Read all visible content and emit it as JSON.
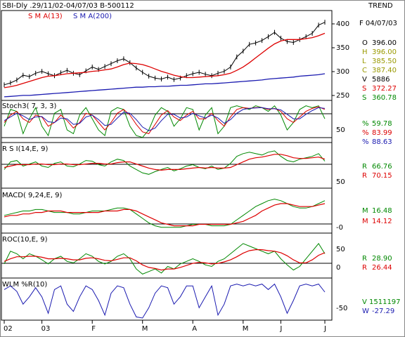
{
  "header": {
    "title": "SBI-Dly .29/11/02-04/07/03 B-500112",
    "indicator": "TREND"
  },
  "colors": {
    "price": "#000000",
    "sma13": "#dd0000",
    "sma200": "#1a1ab0",
    "stoch_k": "#008800",
    "stoch_d": "#dd0000",
    "stoch_third": "#1a1ab0",
    "rsi": "#008800",
    "rsi_avg": "#dd0000",
    "macd": "#008800",
    "macd_signal": "#dd0000",
    "roc": "#008800",
    "roc_avg": "#dd0000",
    "wlm": "#1a1ab0"
  },
  "chart_data": [
    {
      "type": "line",
      "panel": "price",
      "legend": [
        "S M A(13)",
        "S M A(200)"
      ],
      "ylim": [
        240,
        415
      ],
      "yticks": [
        400,
        350,
        300,
        250
      ],
      "date_label": "F 04/07/03",
      "readouts": [
        {
          "label": "O",
          "value": "396.00"
        },
        {
          "label": "H",
          "value": "396.00"
        },
        {
          "label": "L",
          "value": "385.50"
        },
        {
          "label": "C",
          "value": "387.40"
        },
        {
          "label": "V",
          "value": "5886"
        },
        {
          "label": "S",
          "value": "372.27"
        },
        {
          "label": "S",
          "value": "360.78"
        }
      ],
      "series": [
        {
          "name": "Close",
          "values": [
            268,
            272,
            278,
            288,
            285,
            292,
            296,
            291,
            287,
            293,
            298,
            292,
            289,
            297,
            305,
            300,
            306,
            312,
            318,
            322,
            314,
            303,
            294,
            286,
            282,
            280,
            284,
            279,
            282,
            287,
            291,
            294,
            290,
            287,
            292,
            296,
            305,
            326,
            338,
            352,
            355,
            360,
            368,
            377,
            365,
            358,
            356,
            362,
            368,
            375,
            392,
            398
          ]
        },
        {
          "name": "S M A(13)",
          "values": [
            262,
            264,
            267,
            271,
            275,
            279,
            283,
            286,
            287,
            289,
            291,
            292,
            293,
            294,
            296,
            297,
            299,
            301,
            305,
            310,
            313,
            312,
            310,
            306,
            301,
            296,
            292,
            288,
            285,
            283,
            283,
            284,
            285,
            286,
            287,
            289,
            292,
            298,
            305,
            314,
            324,
            334,
            344,
            353,
            359,
            362,
            362,
            362,
            364,
            366,
            370,
            375
          ]
        },
        {
          "name": "S M A(200)",
          "values": [
            243,
            244,
            245,
            246,
            246,
            247,
            248,
            249,
            250,
            251,
            252,
            253,
            254,
            255,
            256,
            257,
            258,
            259,
            260,
            261,
            262,
            263,
            263,
            264,
            264,
            265,
            265,
            266,
            267,
            267,
            268,
            269,
            270,
            270,
            271,
            272,
            273,
            274,
            275,
            276,
            277,
            278,
            280,
            281,
            282,
            283,
            284,
            286,
            287,
            288,
            289,
            291
          ]
        }
      ]
    },
    {
      "type": "line",
      "panel": "stochastic",
      "title": "Stoch3( 7, 3, 3)",
      "ylim": [
        0,
        100
      ],
      "ytick": "50",
      "readouts": [
        {
          "label": "%",
          "value": "59.78"
        },
        {
          "label": "%",
          "value": "83.99"
        },
        {
          "label": "%",
          "value": "88.63"
        }
      ],
      "series": [
        {
          "name": "K",
          "values": [
            40,
            85,
            80,
            20,
            60,
            90,
            40,
            15,
            75,
            85,
            30,
            20,
            70,
            90,
            60,
            30,
            15,
            80,
            90,
            85,
            40,
            15,
            10,
            30,
            70,
            90,
            80,
            40,
            60,
            90,
            85,
            30,
            70,
            90,
            20,
            40,
            90,
            95,
            90,
            85,
            95,
            90,
            80,
            95,
            70,
            30,
            50,
            85,
            95,
            90,
            95,
            60
          ]
        },
        {
          "name": "D",
          "values": [
            50,
            70,
            80,
            60,
            50,
            70,
            65,
            40,
            50,
            70,
            55,
            35,
            50,
            75,
            70,
            50,
            30,
            50,
            75,
            85,
            70,
            45,
            25,
            20,
            45,
            70,
            82,
            65,
            55,
            70,
            80,
            60,
            60,
            75,
            55,
            40,
            65,
            85,
            90,
            88,
            90,
            90,
            85,
            88,
            80,
            60,
            50,
            65,
            80,
            88,
            92,
            85
          ]
        },
        {
          "name": "S",
          "values": [
            55,
            65,
            75,
            68,
            58,
            65,
            66,
            52,
            50,
            62,
            60,
            45,
            48,
            65,
            70,
            58,
            42,
            45,
            62,
            78,
            75,
            58,
            38,
            28,
            35,
            55,
            72,
            72,
            62,
            65,
            75,
            68,
            62,
            70,
            62,
            48,
            58,
            75,
            85,
            88,
            89,
            90,
            87,
            87,
            84,
            72,
            60,
            60,
            72,
            82,
            90,
            88
          ]
        }
      ]
    },
    {
      "type": "line",
      "panel": "rsi",
      "title": "R S I(14,E, 9)",
      "ylim": [
        30,
        90
      ],
      "ytick": "50",
      "reference_line": 70,
      "readouts": [
        {
          "label": "R",
          "value": "66.76"
        },
        {
          "label": "R",
          "value": "70.15"
        }
      ],
      "series": [
        {
          "name": "RSI",
          "values": [
            55,
            66,
            68,
            60,
            63,
            66,
            60,
            58,
            64,
            66,
            60,
            59,
            63,
            68,
            67,
            62,
            60,
            66,
            70,
            68,
            60,
            55,
            50,
            48,
            52,
            55,
            58,
            53,
            56,
            60,
            62,
            58,
            56,
            60,
            55,
            57,
            64,
            74,
            78,
            80,
            78,
            76,
            80,
            82,
            74,
            68,
            66,
            70,
            72,
            74,
            78,
            67
          ]
        },
        {
          "name": "Average",
          "values": [
            58,
            60,
            62,
            62,
            62,
            63,
            63,
            62,
            62,
            63,
            63,
            62,
            62,
            63,
            64,
            64,
            63,
            63,
            65,
            66,
            66,
            63,
            60,
            57,
            55,
            54,
            55,
            55,
            55,
            56,
            57,
            58,
            57,
            58,
            57,
            57,
            58,
            62,
            66,
            70,
            72,
            73,
            75,
            77,
            77,
            75,
            72,
            71,
            71,
            72,
            73,
            70
          ]
        }
      ]
    },
    {
      "type": "line",
      "panel": "macd",
      "title": "MACD( 9,24,E, 9)",
      "ylim": [
        -4,
        24
      ],
      "ytick": "-0",
      "reference_line": 0,
      "readouts": [
        {
          "label": "M",
          "value": "16.48"
        },
        {
          "label": "M",
          "value": "14.12"
        }
      ],
      "series": [
        {
          "name": "MACD",
          "values": [
            7,
            8,
            9,
            10,
            10,
            11,
            11,
            10,
            9,
            9,
            9,
            8,
            8,
            9,
            10,
            10,
            10,
            11,
            12,
            12,
            11,
            8,
            5,
            2,
            0,
            -1,
            -1,
            -1,
            -1,
            0,
            1,
            1,
            1,
            0,
            0,
            0,
            1,
            4,
            7,
            10,
            13,
            15,
            17,
            18,
            17,
            15,
            13,
            12,
            12,
            13,
            15,
            17
          ]
        },
        {
          "name": "Signal",
          "values": [
            6,
            7,
            7,
            8,
            8,
            9,
            9,
            10,
            10,
            10,
            9,
            9,
            9,
            9,
            9,
            9,
            10,
            10,
            10,
            11,
            11,
            10,
            8,
            6,
            4,
            2,
            1,
            0,
            0,
            0,
            0,
            1,
            1,
            1,
            1,
            1,
            1,
            2,
            3,
            5,
            7,
            10,
            12,
            14,
            15,
            15,
            14,
            13,
            13,
            13,
            14,
            15
          ]
        }
      ]
    },
    {
      "type": "line",
      "panel": "roc",
      "title": "ROC(10,E, 9)",
      "ylim": [
        -15,
        65
      ],
      "yticks": [
        "50",
        "0"
      ],
      "reference_line": 0,
      "readouts": [
        {
          "label": "R",
          "value": "28.90"
        },
        {
          "label": "R",
          "value": "26.44"
        }
      ],
      "series": [
        {
          "name": "ROC",
          "values": [
            10,
            35,
            30,
            20,
            30,
            25,
            18,
            10,
            20,
            25,
            15,
            12,
            20,
            30,
            25,
            15,
            10,
            15,
            25,
            30,
            20,
            0,
            -10,
            -5,
            0,
            -8,
            5,
            0,
            10,
            15,
            20,
            15,
            8,
            5,
            15,
            20,
            30,
            40,
            50,
            45,
            40,
            35,
            30,
            35,
            20,
            8,
            -2,
            5,
            20,
            35,
            50,
            30
          ]
        },
        {
          "name": "Average",
          "values": [
            15,
            20,
            24,
            24,
            25,
            25,
            23,
            20,
            20,
            21,
            20,
            18,
            18,
            21,
            22,
            20,
            17,
            16,
            19,
            22,
            22,
            16,
            8,
            3,
            1,
            -2,
            0,
            0,
            3,
            7,
            11,
            13,
            12,
            10,
            11,
            14,
            18,
            24,
            31,
            36,
            38,
            38,
            36,
            35,
            32,
            26,
            18,
            12,
            12,
            18,
            27,
            32
          ]
        }
      ]
    },
    {
      "type": "line",
      "panel": "wlm",
      "title": "WLM %R(10)",
      "ylim": [
        -100,
        0
      ],
      "ytick": "-50",
      "readouts": [
        {
          "label": "V",
          "value": "1511197"
        },
        {
          "label": "W",
          "value": "-27.29"
        }
      ],
      "series": [
        {
          "name": "%R",
          "values": [
            -20,
            -10,
            -25,
            -60,
            -40,
            -15,
            -40,
            -85,
            -20,
            -10,
            -60,
            -80,
            -40,
            -10,
            -20,
            -50,
            -90,
            -30,
            -10,
            -15,
            -60,
            -95,
            -98,
            -70,
            -30,
            -10,
            -15,
            -60,
            -40,
            -10,
            -10,
            -70,
            -40,
            -10,
            -90,
            -60,
            -10,
            -5,
            -10,
            -5,
            -10,
            -5,
            -20,
            -5,
            -40,
            -85,
            -50,
            -10,
            -5,
            -10,
            -5,
            -27
          ]
        }
      ]
    }
  ],
  "x_axis": {
    "labels": [
      "02",
      "03",
      "F",
      "M",
      "A",
      "M",
      "J",
      "J"
    ],
    "label_index": [
      0,
      6,
      14,
      22,
      30,
      38,
      44,
      51
    ]
  }
}
